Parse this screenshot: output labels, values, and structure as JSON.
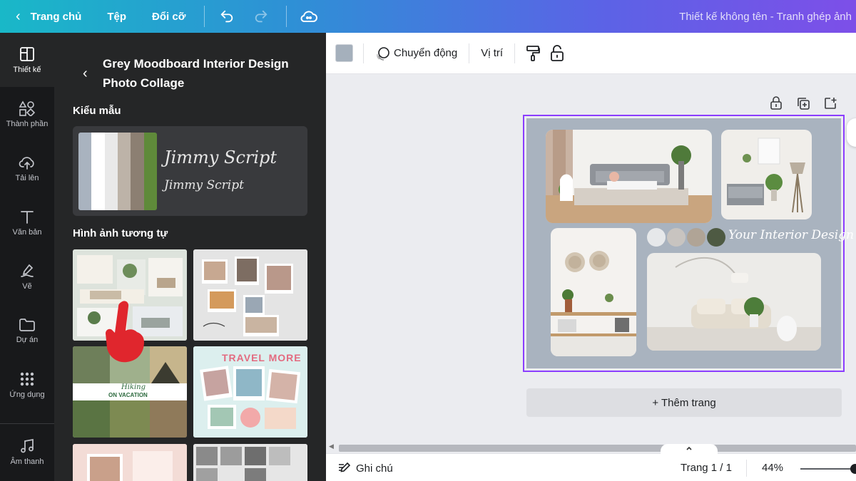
{
  "topbar": {
    "home_label": "Trang chủ",
    "file_label": "Tệp",
    "resize_label": "Đổi cỡ",
    "document_title": "Thiết kế không tên - Tranh ghép ảnh"
  },
  "rail": {
    "items": [
      {
        "label": "Thiết kế",
        "icon": "layout-icon"
      },
      {
        "label": "Thành phần",
        "icon": "elements-icon"
      },
      {
        "label": "Tải lên",
        "icon": "upload-cloud-icon"
      },
      {
        "label": "Văn bản",
        "icon": "text-icon"
      },
      {
        "label": "Vẽ",
        "icon": "draw-icon"
      },
      {
        "label": "Dự án",
        "icon": "folder-icon"
      },
      {
        "label": "Ứng dụng",
        "icon": "apps-grid-icon"
      },
      {
        "label": "Âm thanh",
        "icon": "music-note-icon"
      }
    ]
  },
  "panel": {
    "template_title": "Grey Moodboard Interior Design Photo Collage",
    "styles_heading": "Kiểu mẫu",
    "style_swatches": [
      "#a9b3bf",
      "#ffffff",
      "#e9e9e9",
      "#bdb3a8",
      "#8c7f72",
      "#5f8a3a"
    ],
    "font_name_large": "Jimmy Script",
    "font_name_small": "Jimmy Script",
    "similar_heading": "Hình ảnh tương tự",
    "thumb_hiking_title": "Hiking",
    "thumb_hiking_subtitle": "ON VACATION",
    "thumb_travel_title": "TRAVEL MORE"
  },
  "toolbar": {
    "color_value": "#a5b0bc",
    "animate_label": "Chuyển động",
    "position_label": "Vị trí"
  },
  "canvas": {
    "background_color": "#a9b3bf",
    "palette": [
      "#e6e8ea",
      "#c8c4c0",
      "#b0a496",
      "#4e5a43"
    ],
    "script_text": "Your Interior Design",
    "add_page_label": "+ Thêm trang"
  },
  "bottombar": {
    "notes_label": "Ghi chú",
    "page_label": "Trang 1 / 1",
    "zoom_label": "44%"
  }
}
